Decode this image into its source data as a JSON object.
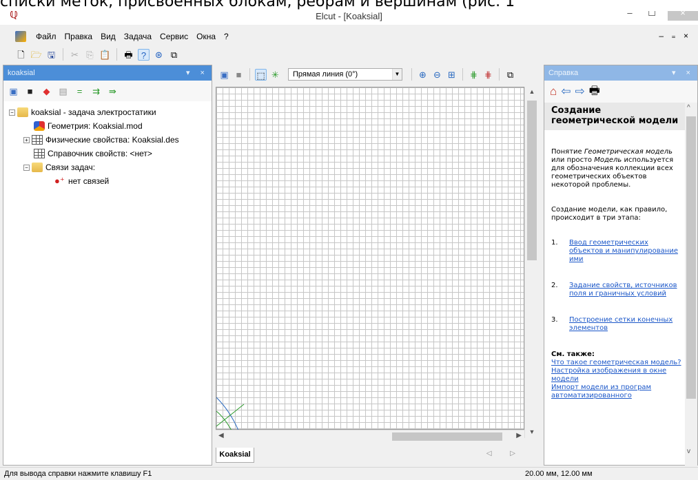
{
  "caption_overlay": "списки меток, присвоенных блокам, ребрам и вершинам (рис. 1",
  "window": {
    "title": "Elcut - [Koaksial]",
    "minimize": "–",
    "maximize": "☐",
    "close": "×"
  },
  "menu": [
    "Файл",
    "Правка",
    "Вид",
    "Задача",
    "Сервис",
    "Окна",
    "?"
  ],
  "mdi_controls": "– ₌ ×",
  "left_panel": {
    "title": "koaksial",
    "controls": "▾ ×",
    "tree": [
      {
        "label": "koaksial - задача электростатики",
        "expander": "−"
      },
      {
        "label": "Геометрия: Koaksial.mod"
      },
      {
        "label": "Физические свойства: Koaksial.des",
        "expander": "+"
      },
      {
        "label": "Справочник свойств: <нет>"
      },
      {
        "label": "Связи задач:",
        "expander": "−"
      },
      {
        "label": "нет связей"
      }
    ]
  },
  "center": {
    "line_type_select": "Прямая линия (0°)",
    "doc_tab": "Koaksial",
    "tab_nav": "◁ ▷"
  },
  "help_panel": {
    "title": "Справка",
    "controls": "▾ ×",
    "heading": "Создание геометрической модели",
    "p1_a": "Понятие ",
    "p1_em": "Геометрическая модель",
    "p1_b": " или просто ",
    "p1_em2": "Модель",
    "p1_c": " используется для обозначения коллекции всех геометрических объектов некоторой проблемы.",
    "p2": "Создание модели, как правило, происходит в три этапа:",
    "steps": [
      {
        "num": "1.",
        "text": "Ввод геометрических объектов и манипулирование ими"
      },
      {
        "num": "2.",
        "text": "Задание свойств, источников поля и граничных условий"
      },
      {
        "num": "3.",
        "text": "Построение сетки конечных элементов"
      }
    ],
    "see_also": "См. также:",
    "links": [
      "Что такое геометрическая модель?",
      "Настройка изображения в окне модели",
      "Импорт модели из програм автоматизированного"
    ]
  },
  "status": {
    "hint": "Для вывода справки нажмите клавишу F1",
    "coords": "20.00 мм, 12.00 мм"
  },
  "colors": {
    "panel_head_active": "#4c8ed8",
    "panel_head_inactive": "#8fb7e6",
    "link": "#1a56c8"
  }
}
